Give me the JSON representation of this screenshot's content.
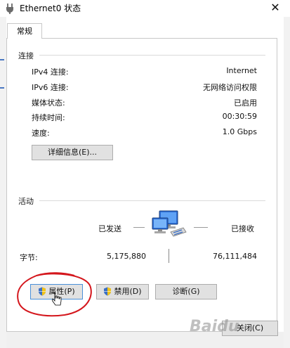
{
  "window": {
    "title": "Ethernet0 状态",
    "close_glyph": "✕",
    "title_icon": "network-adapter-icon"
  },
  "tabs": [
    {
      "label": "常规"
    }
  ],
  "connection": {
    "header": "连接",
    "rows": [
      {
        "label": "IPv4 连接:",
        "value": "Internet"
      },
      {
        "label": "IPv6 连接:",
        "value": "无网络访问权限"
      },
      {
        "label": "媒体状态:",
        "value": "已启用"
      },
      {
        "label": "持续时间:",
        "value": "00:30:59"
      },
      {
        "label": "速度:",
        "value": "1.0 Gbps"
      }
    ],
    "details_button": "详细信息(E)..."
  },
  "activity": {
    "header": "活动",
    "sent_label": "已发送",
    "received_label": "已接收",
    "bytes_label": "字节:",
    "sent_bytes": "5,175,880",
    "received_bytes": "76,111,484",
    "icon": "network-computers-icon"
  },
  "buttons": {
    "properties": "属性(P)",
    "disable": "禁用(D)",
    "diagnose": "诊断(G)",
    "close": "关闭(C)"
  },
  "watermark": "Baidu",
  "colors": {
    "annotation_red": "#d4161c",
    "button_face": "#e1e1e1",
    "button_border": "#adadad",
    "focus_border": "#4a90d9",
    "shield_blue": "#3b6fc4",
    "shield_yellow": "#f2c318"
  }
}
